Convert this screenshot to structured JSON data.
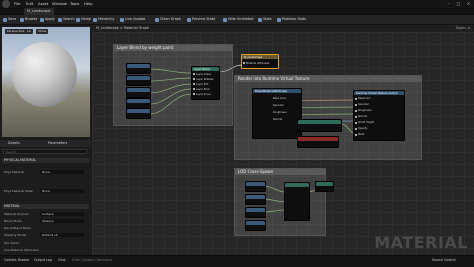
{
  "titlebar": {
    "menus": [
      "File",
      "Edit",
      "Asset",
      "Window",
      "Tools",
      "Help"
    ],
    "window_buttons": [
      "–",
      "□",
      "✕"
    ]
  },
  "tabs": [
    "M_Landscape"
  ],
  "toolbar": [
    "Save",
    "Browse",
    "Apply",
    "Search",
    "Home",
    "Hierarchy",
    "Live Update",
    "Clean Graph",
    "Preview State",
    "Hide Unrelated",
    "Stats",
    "Platform Stats"
  ],
  "viewport": {
    "buttons": [
      "Perspective",
      "Lit",
      "Show"
    ]
  },
  "details": {
    "tabs": [
      "Details",
      "Parameters"
    ],
    "search_placeholder": "Search",
    "sections": [
      {
        "title": "PHYSICAL MATERIAL",
        "props": [
          {
            "label": "Phys Material",
            "value": "None"
          },
          {
            "label": "Phys Material Mask",
            "value": "None"
          }
        ]
      },
      {
        "title": "MATERIAL",
        "props": [
          {
            "label": "Material Domain",
            "value": "Surface"
          },
          {
            "label": "Blend Mode",
            "value": "Opaque"
          },
          {
            "label": "Decal Blend Mode",
            "value": ""
          },
          {
            "label": "Shading Model",
            "value": "Default Lit"
          },
          {
            "label": "Two Sided",
            "value": ""
          },
          {
            "label": "Use Material Attributes",
            "value": ""
          }
        ]
      }
    ]
  },
  "graph": {
    "breadcrumb": "M_Landscape  >  Material Graph",
    "zoom": "Zoom -4",
    "watermark": "MATERIAL",
    "comments": [
      "Layer Blend by weight paint",
      "Render into Runtime Virtual Texture",
      "LOD Cross-Spawn"
    ],
    "nodes": {
      "layer_blend": {
        "title": "Layer Blend",
        "pins": [
          "Layer Grass",
          "Layer Pebbles",
          "Layer Dirt",
          "Layer Rock",
          "Layer Snow"
        ]
      },
      "output": {
        "title": "M_Landscape",
        "pins": [
          "Material Attributes"
        ]
      },
      "rvt_out": {
        "title": "Runtime Virtual Texture Output",
        "pins": [
          "BaseColor",
          "Specular",
          "Roughness",
          "Normal",
          "World Height",
          "Opacity",
          "Mask"
        ]
      },
      "break": {
        "title": "BreakMaterialAttributes",
        "pins": [
          "Base Color",
          "Specular",
          "Roughness",
          "Normal"
        ]
      }
    }
  },
  "status": {
    "items": [
      "Content Drawer",
      "Output Log",
      "Cmd",
      "Enter Console Command",
      "Source Control"
    ]
  }
}
